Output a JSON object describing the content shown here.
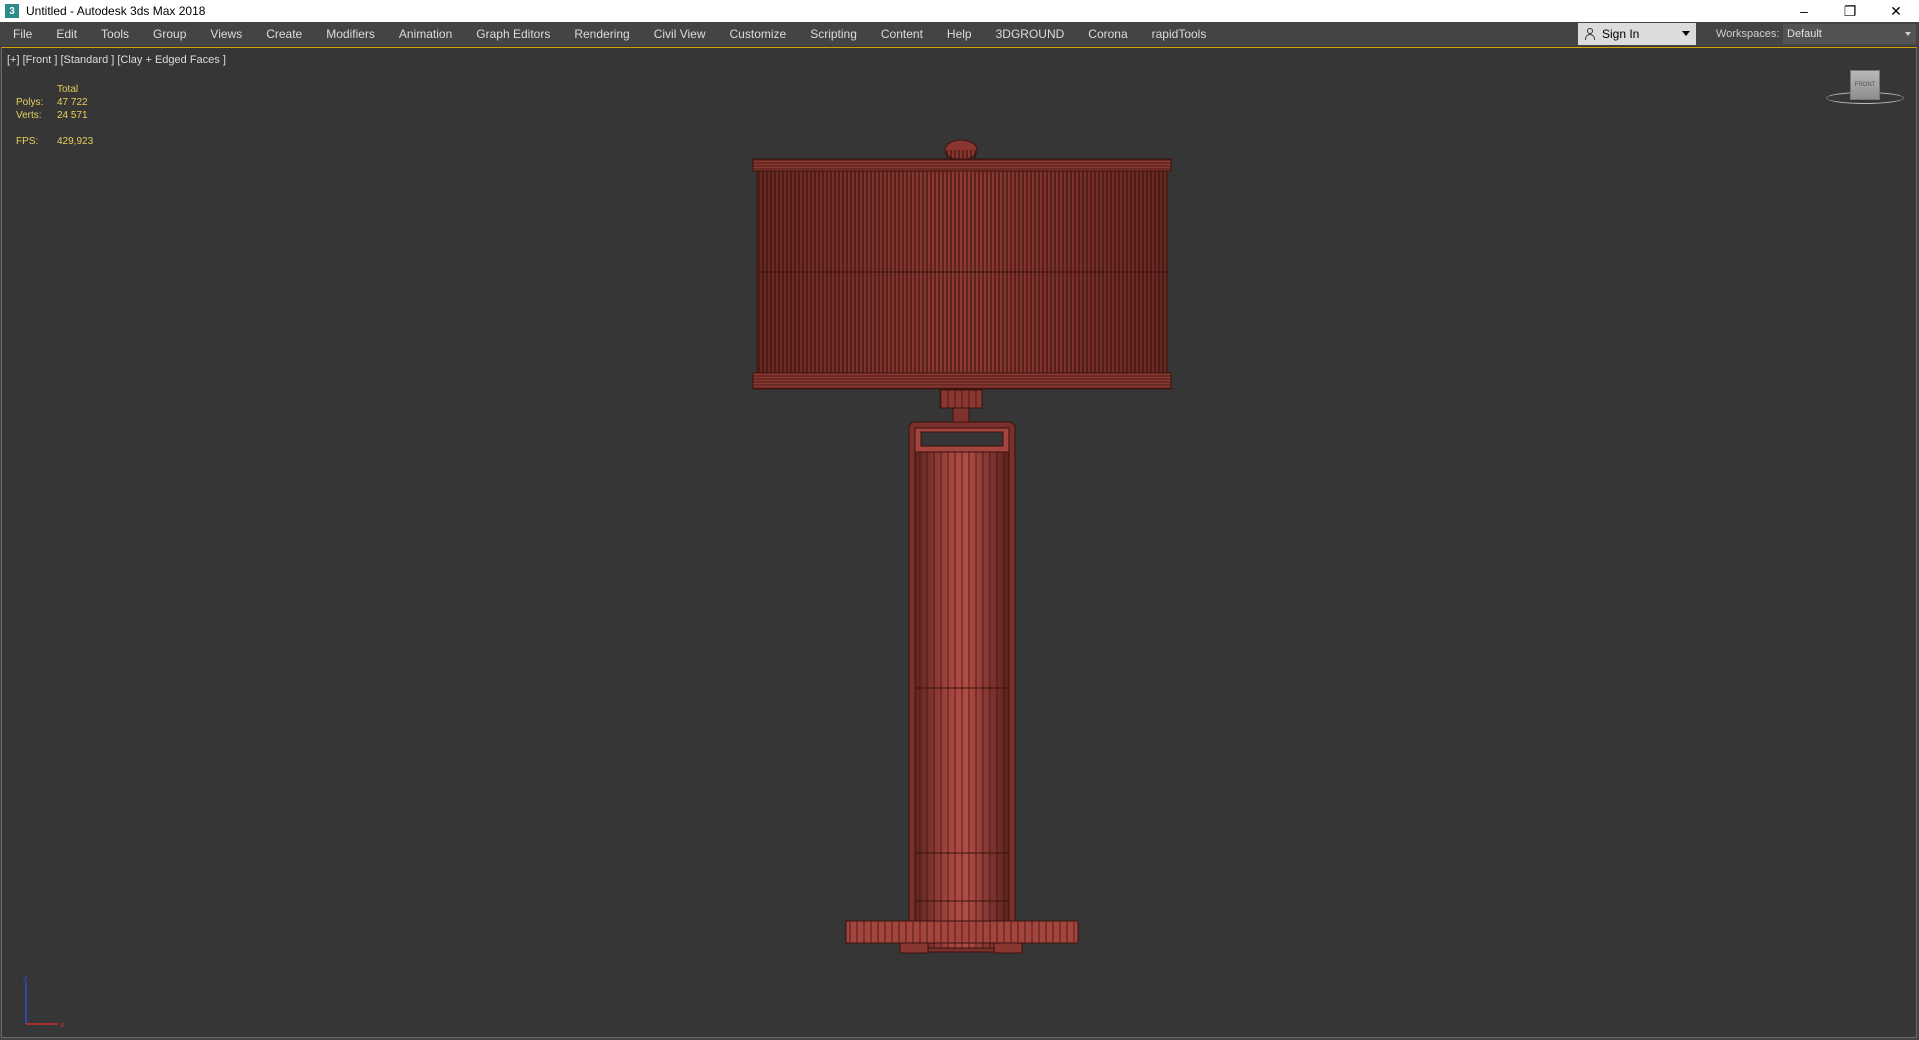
{
  "window": {
    "title": "Untitled - Autodesk 3ds Max 2018",
    "icon": "3dsmax-app-icon",
    "controls": [
      "minimize",
      "restore",
      "close"
    ]
  },
  "menu": {
    "items": [
      "File",
      "Edit",
      "Tools",
      "Group",
      "Views",
      "Create",
      "Modifiers",
      "Animation",
      "Graph Editors",
      "Rendering",
      "Civil View",
      "Customize",
      "Scripting",
      "Content",
      "Help",
      "3DGROUND",
      "Corona",
      "rapidTools"
    ],
    "signin": "Sign In",
    "workspaces_label": "Workspaces:",
    "workspace_value": "Default"
  },
  "viewport": {
    "label": "[+] [Front ] [Standard ] [Clay + Edged Faces ]",
    "stats": {
      "header": "Total",
      "polys_label": "Polys:",
      "polys_value": "47 722",
      "verts_label": "Verts:",
      "verts_value": "24 571",
      "fps_label": "FPS:",
      "fps_value": "429,923"
    },
    "viewcube_face": "FRONT",
    "colors": {
      "background": "#363636",
      "model_fill": "#8e3a34",
      "model_wire": "#3a1210",
      "stats_text": "#e6d05a"
    }
  }
}
